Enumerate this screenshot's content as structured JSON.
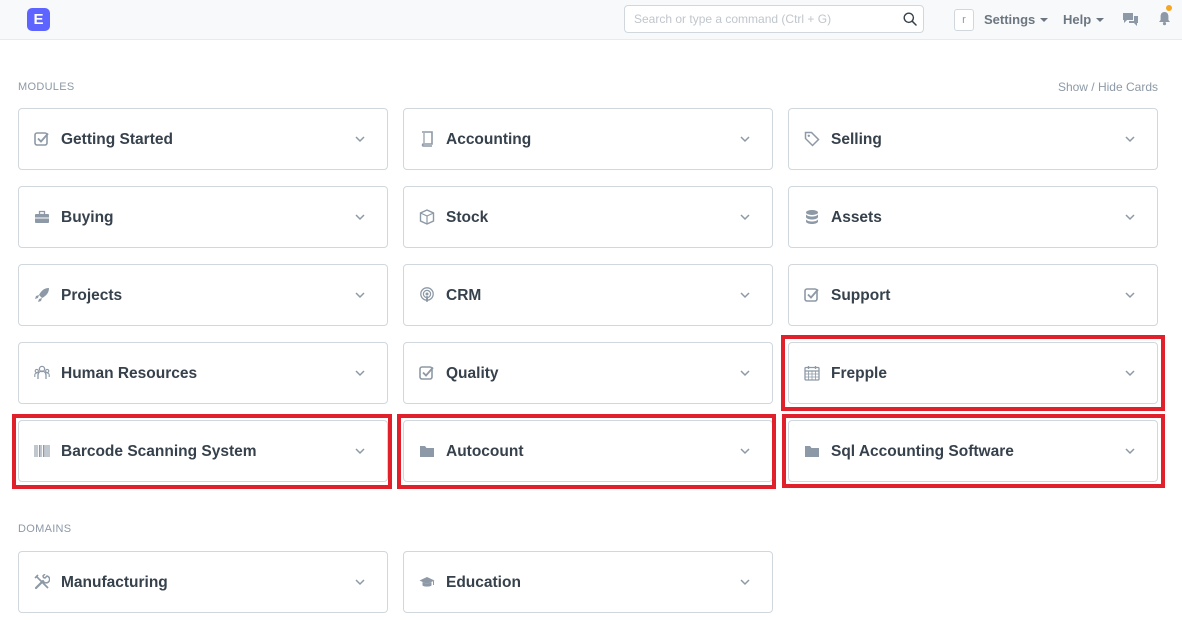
{
  "app": {
    "logo_letter": "E"
  },
  "search": {
    "placeholder": "Search or type a command (Ctrl + G)"
  },
  "user": {
    "avatar_letter": "r"
  },
  "nav": {
    "settings": "Settings",
    "help": "Help"
  },
  "colors": {
    "brand": "#5e64ff",
    "highlight": "#e0202b",
    "notification": "#f5a623"
  },
  "modules": {
    "heading": "MODULES",
    "toggle": "Show / Hide Cards",
    "cards": [
      {
        "label": "Getting Started",
        "icon": "checkbox-icon"
      },
      {
        "label": "Accounting",
        "icon": "book-icon"
      },
      {
        "label": "Selling",
        "icon": "tag-icon"
      },
      {
        "label": "Buying",
        "icon": "briefcase-icon"
      },
      {
        "label": "Stock",
        "icon": "box-icon"
      },
      {
        "label": "Assets",
        "icon": "database-icon"
      },
      {
        "label": "Projects",
        "icon": "rocket-icon"
      },
      {
        "label": "CRM",
        "icon": "podcast-icon"
      },
      {
        "label": "Support",
        "icon": "checkbox-icon"
      },
      {
        "label": "Human Resources",
        "icon": "users-icon"
      },
      {
        "label": "Quality",
        "icon": "checkbox-icon"
      },
      {
        "label": "Frepple",
        "icon": "calendar-icon"
      },
      {
        "label": "Barcode Scanning System",
        "icon": "barcode-icon"
      },
      {
        "label": "Autocount",
        "icon": "folder-icon"
      },
      {
        "label": "Sql Accounting Software",
        "icon": "folder-icon"
      }
    ]
  },
  "domains": {
    "heading": "DOMAINS",
    "cards": [
      {
        "label": "Manufacturing",
        "icon": "tools-icon"
      },
      {
        "label": "Education",
        "icon": "graduation-cap-icon"
      }
    ]
  }
}
